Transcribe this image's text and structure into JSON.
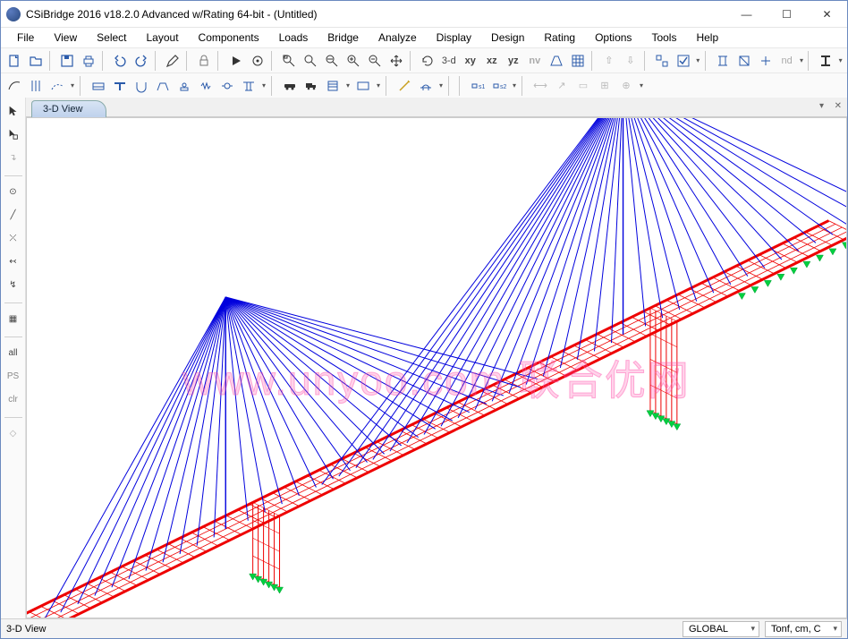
{
  "window": {
    "title": "CSiBridge 2016 v18.2.0 Advanced w/Rating 64-bit - (Untitled)"
  },
  "menu": {
    "items": [
      "File",
      "View",
      "Select",
      "Layout",
      "Components",
      "Loads",
      "Bridge",
      "Analyze",
      "Display",
      "Design",
      "Rating",
      "Options",
      "Tools",
      "Help"
    ]
  },
  "toolbar_row1_labels": {
    "view3d": "3-d",
    "xy": "xy",
    "xz": "xz",
    "yz": "yz",
    "nv": "nv",
    "nd": "nd"
  },
  "sidebar_labels": {
    "all": "all",
    "ps": "PS",
    "clr": "clr"
  },
  "tab": {
    "label": "3-D View"
  },
  "statusbar": {
    "left": "3-D View",
    "coord": "GLOBAL",
    "units": "Tonf, cm, C"
  },
  "watermark": "www.unyoo.com 联合优网"
}
